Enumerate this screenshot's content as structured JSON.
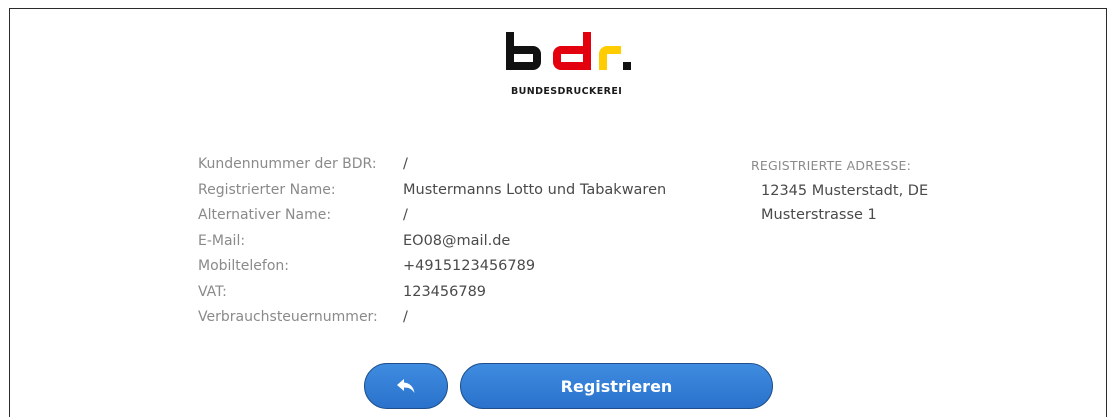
{
  "logo": {
    "text": "BUNDESDRUCKEREI",
    "colors": {
      "black": "#111111",
      "red": "#e3000f",
      "gold": "#ffcc00"
    }
  },
  "customer": {
    "rows": [
      {
        "label": "Kundennummer der BDR:",
        "value": "/"
      },
      {
        "label": "Registrierter Name:",
        "value": "Mustermanns Lotto und Tabakwaren"
      },
      {
        "label": "Alternativer Name:",
        "value": "/"
      },
      {
        "label": "E-Mail:",
        "value": "EO08@mail.de"
      },
      {
        "label": "Mobiltelefon:",
        "value": "+4915123456789"
      },
      {
        "label": "VAT:",
        "value": "123456789"
      },
      {
        "label": "Verbrauchsteuernummer:",
        "value": "/"
      }
    ]
  },
  "address": {
    "heading": "REGISTRIERTE ADRESSE:",
    "line1": "12345 Musterstadt, DE",
    "line2": "Musterstrasse 1"
  },
  "actions": {
    "back_icon": "reply-arrow-icon",
    "register_label": "Registrieren",
    "accent": "#2f7bd6"
  }
}
